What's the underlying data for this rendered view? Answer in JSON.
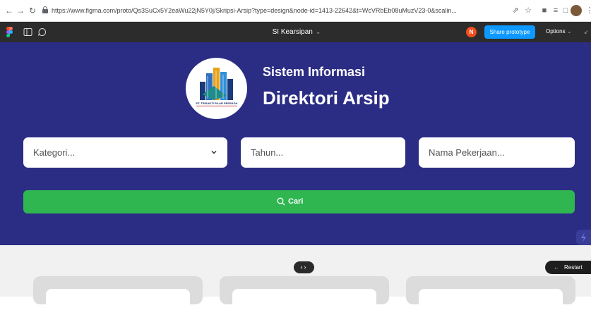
{
  "browser": {
    "url": "https://www.figma.com/proto/Qs3SuCx5Y2eaWu22jN5Y0j/Skripsi-Arsip?type=design&node-id=1413-22642&t=WcVRbEb08uMuzV23-0&scalin...",
    "icons": [
      "back-icon",
      "forward-icon",
      "reload-icon",
      "lock-icon",
      "share-icon",
      "star-icon",
      "extensions-icon",
      "reading-list-icon",
      "side-panel-icon",
      "profile-icon",
      "more-icon"
    ]
  },
  "figma": {
    "file_title": "SI Kearsipan",
    "avatar_initial": "N",
    "share_label": "Share prototype",
    "options_label": "Options"
  },
  "hero": {
    "title_line1": "Sistem Informasi",
    "title_line2": "Direktori Arsip",
    "logo_caption": "PT. TRISAKTI PILAR PERSADA"
  },
  "search": {
    "kategori_placeholder": "Kategori...",
    "tahun_placeholder": "Tahun...",
    "nama_placeholder": "Nama Pekerjaan...",
    "button_label": "Cari"
  },
  "prototype": {
    "restart_label": "Restart"
  },
  "colors": {
    "hero_bg": "#2b2d84",
    "button_green": "#2fb650",
    "share_blue": "#0d99ff",
    "figma_bar": "#2c2c2c"
  }
}
